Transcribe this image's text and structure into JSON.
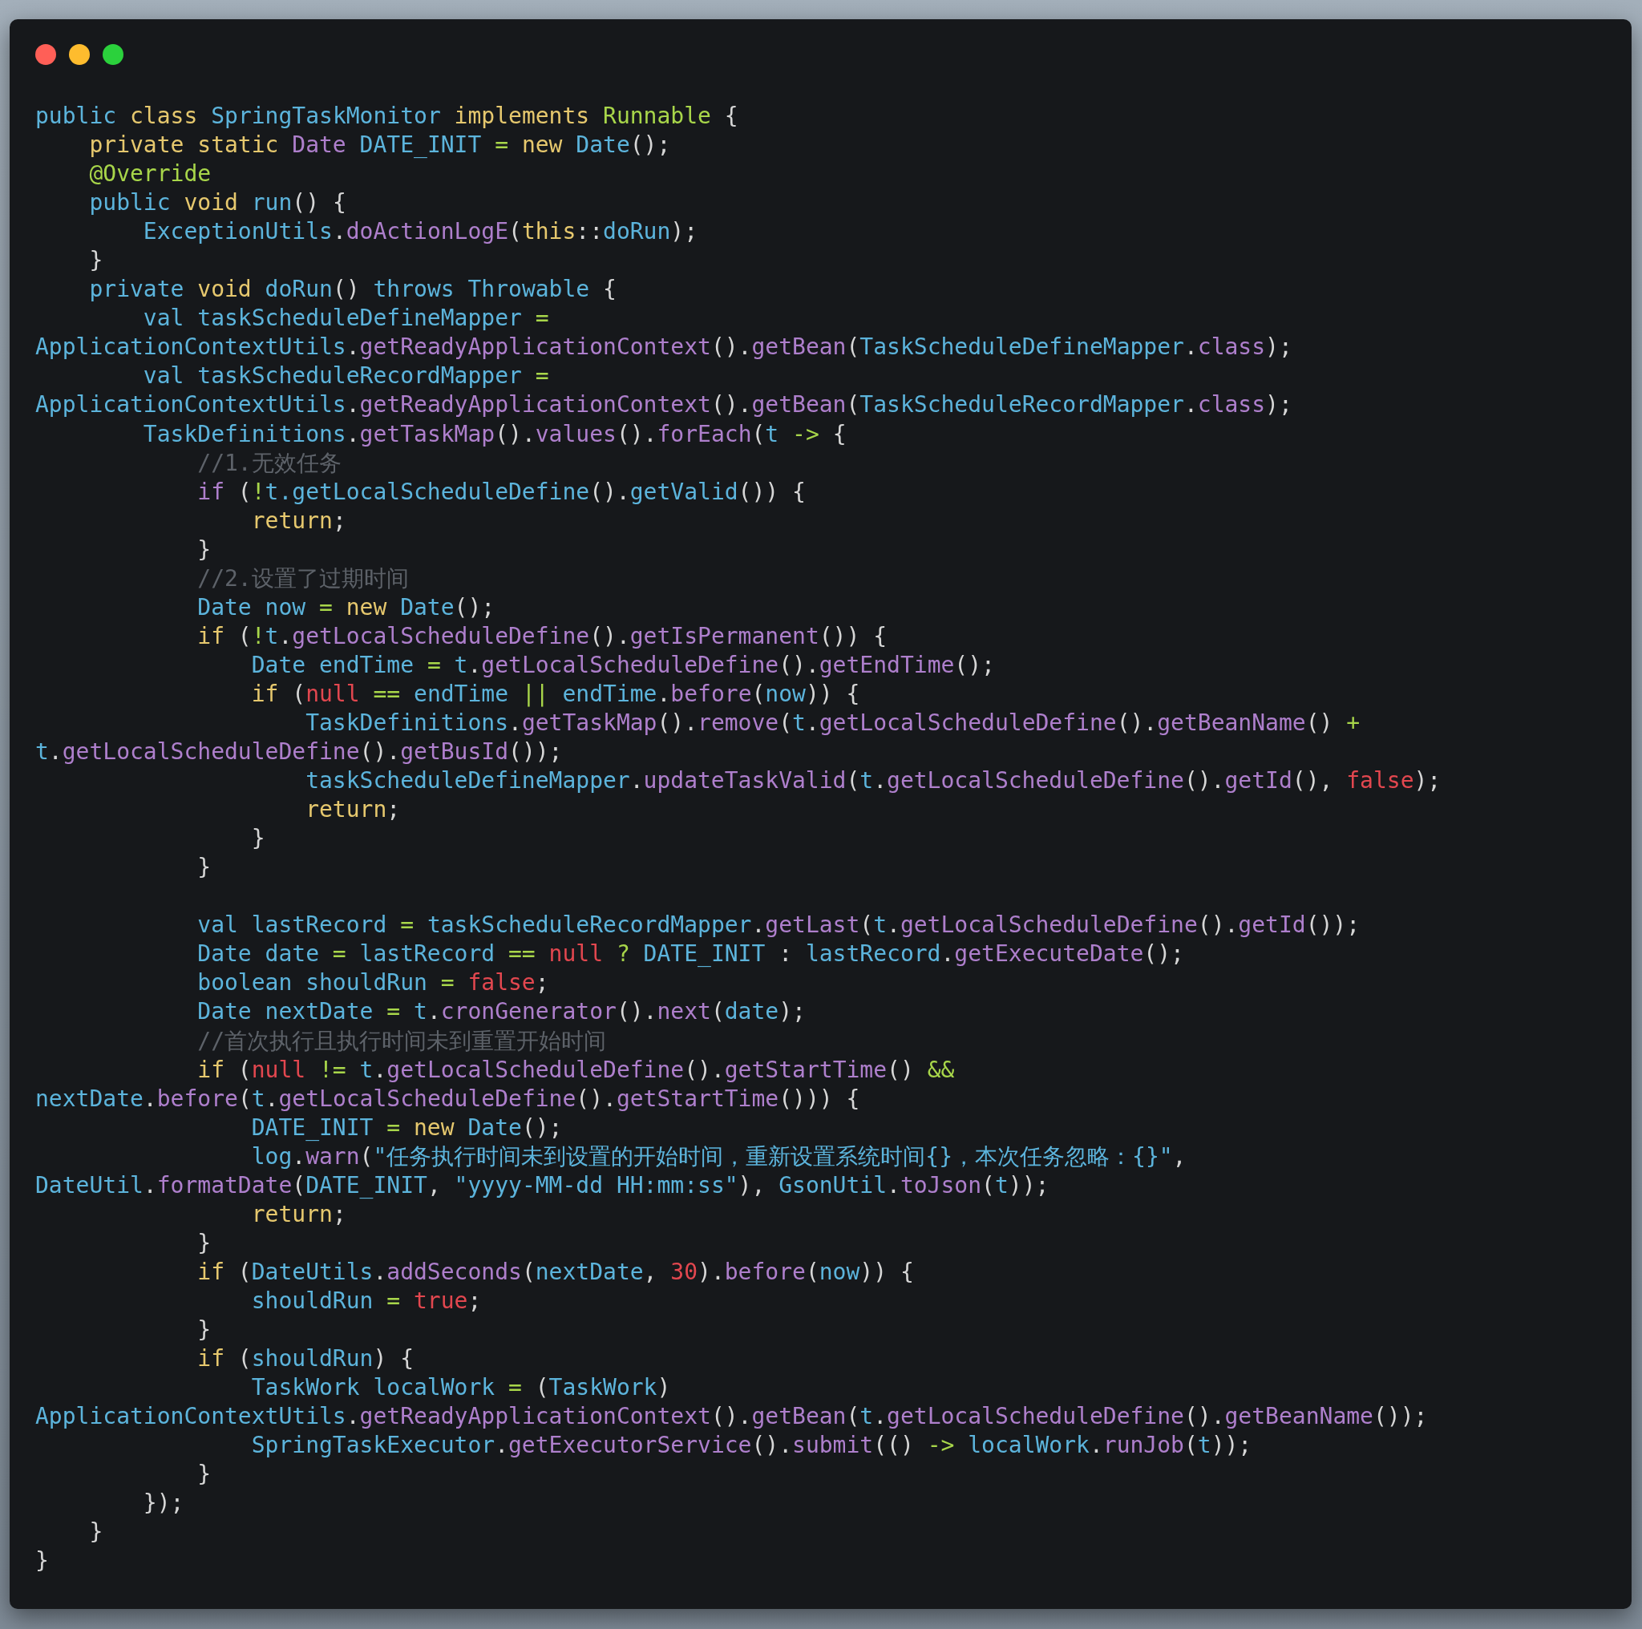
{
  "window": {
    "kind": "code-window"
  },
  "lines": [
    {
      "segments": [
        {
          "kind": "name",
          "text": "public "
        },
        {
          "kind": "keyword",
          "text": "class "
        },
        {
          "kind": "name",
          "text": "SpringTaskMonitor "
        },
        {
          "kind": "keyword",
          "text": "implements "
        },
        {
          "kind": "operator",
          "text": "Runnable "
        },
        {
          "kind": "punct",
          "text": "{"
        }
      ]
    },
    {
      "segments": [
        {
          "kind": "keyword",
          "text": "    private static "
        },
        {
          "kind": "method",
          "text": "Date "
        },
        {
          "kind": "name",
          "text": "DATE_INIT "
        },
        {
          "kind": "operator",
          "text": "= "
        },
        {
          "kind": "keyword",
          "text": "new "
        },
        {
          "kind": "name",
          "text": "Date"
        },
        {
          "kind": "punct",
          "text": "();"
        }
      ]
    },
    {
      "segments": [
        {
          "kind": "operator",
          "text": "    @Override"
        }
      ]
    },
    {
      "segments": [
        {
          "kind": "name",
          "text": "    public "
        },
        {
          "kind": "keyword",
          "text": "void "
        },
        {
          "kind": "name",
          "text": "run"
        },
        {
          "kind": "punct",
          "text": "() {"
        }
      ]
    },
    {
      "segments": [
        {
          "kind": "name",
          "text": "        ExceptionUtils"
        },
        {
          "kind": "punct",
          "text": "."
        },
        {
          "kind": "method",
          "text": "doActionLogE"
        },
        {
          "kind": "punct",
          "text": "("
        },
        {
          "kind": "keyword",
          "text": "this"
        },
        {
          "kind": "punct",
          "text": "::"
        },
        {
          "kind": "name",
          "text": "doRun"
        },
        {
          "kind": "punct",
          "text": ");"
        }
      ]
    },
    {
      "segments": [
        {
          "kind": "punct",
          "text": "    }"
        }
      ]
    },
    {
      "segments": [
        {
          "kind": "name",
          "text": "    private "
        },
        {
          "kind": "keyword",
          "text": "void "
        },
        {
          "kind": "name",
          "text": "doRun"
        },
        {
          "kind": "punct",
          "text": "() "
        },
        {
          "kind": "name",
          "text": "throws Throwable "
        },
        {
          "kind": "punct",
          "text": "{"
        }
      ]
    },
    {
      "segments": [
        {
          "kind": "name",
          "text": "        val taskScheduleDefineMapper "
        },
        {
          "kind": "operator",
          "text": "="
        }
      ]
    },
    {
      "segments": [
        {
          "kind": "name",
          "text": "ApplicationContextUtils"
        },
        {
          "kind": "punct",
          "text": "."
        },
        {
          "kind": "method",
          "text": "getReadyApplicationContext"
        },
        {
          "kind": "punct",
          "text": "()."
        },
        {
          "kind": "method",
          "text": "getBean"
        },
        {
          "kind": "punct",
          "text": "("
        },
        {
          "kind": "name",
          "text": "TaskScheduleDefineMapper"
        },
        {
          "kind": "punct",
          "text": "."
        },
        {
          "kind": "method",
          "text": "class"
        },
        {
          "kind": "punct",
          "text": ");"
        }
      ]
    },
    {
      "segments": [
        {
          "kind": "name",
          "text": "        val taskScheduleRecordMapper "
        },
        {
          "kind": "operator",
          "text": "="
        }
      ]
    },
    {
      "segments": [
        {
          "kind": "name",
          "text": "ApplicationContextUtils"
        },
        {
          "kind": "punct",
          "text": "."
        },
        {
          "kind": "method",
          "text": "getReadyApplicationContext"
        },
        {
          "kind": "punct",
          "text": "()."
        },
        {
          "kind": "method",
          "text": "getBean"
        },
        {
          "kind": "punct",
          "text": "("
        },
        {
          "kind": "name",
          "text": "TaskScheduleRecordMapper"
        },
        {
          "kind": "punct",
          "text": "."
        },
        {
          "kind": "method",
          "text": "class"
        },
        {
          "kind": "punct",
          "text": ");"
        }
      ]
    },
    {
      "segments": [
        {
          "kind": "name",
          "text": "        TaskDefinitions"
        },
        {
          "kind": "punct",
          "text": "."
        },
        {
          "kind": "method",
          "text": "getTaskMap"
        },
        {
          "kind": "punct",
          "text": "()."
        },
        {
          "kind": "method",
          "text": "values"
        },
        {
          "kind": "punct",
          "text": "()."
        },
        {
          "kind": "method",
          "text": "forEach"
        },
        {
          "kind": "punct",
          "text": "("
        },
        {
          "kind": "name",
          "text": "t "
        },
        {
          "kind": "operator",
          "text": "-> "
        },
        {
          "kind": "punct",
          "text": "{"
        }
      ]
    },
    {
      "segments": [
        {
          "kind": "comment",
          "text": "            //1.无效任务"
        }
      ]
    },
    {
      "segments": [
        {
          "kind": "method",
          "text": "            if "
        },
        {
          "kind": "punct",
          "text": "("
        },
        {
          "kind": "operator",
          "text": "!"
        },
        {
          "kind": "name",
          "text": "t.getLocalScheduleDefine"
        },
        {
          "kind": "punct",
          "text": "()."
        },
        {
          "kind": "name",
          "text": "getValid"
        },
        {
          "kind": "punct",
          "text": "()) {"
        }
      ]
    },
    {
      "segments": [
        {
          "kind": "keyword",
          "text": "                return"
        },
        {
          "kind": "punct",
          "text": ";"
        }
      ]
    },
    {
      "segments": [
        {
          "kind": "punct",
          "text": "            }"
        }
      ]
    },
    {
      "segments": [
        {
          "kind": "comment",
          "text": "            //2.设置了过期时间"
        }
      ]
    },
    {
      "segments": [
        {
          "kind": "name",
          "text": "            Date now "
        },
        {
          "kind": "operator",
          "text": "= "
        },
        {
          "kind": "keyword",
          "text": "new "
        },
        {
          "kind": "name",
          "text": "Date"
        },
        {
          "kind": "punct",
          "text": "();"
        }
      ]
    },
    {
      "segments": [
        {
          "kind": "keyword",
          "text": "            if "
        },
        {
          "kind": "punct",
          "text": "("
        },
        {
          "kind": "operator",
          "text": "!"
        },
        {
          "kind": "name",
          "text": "t"
        },
        {
          "kind": "punct",
          "text": "."
        },
        {
          "kind": "method",
          "text": "getLocalScheduleDefine"
        },
        {
          "kind": "punct",
          "text": "()."
        },
        {
          "kind": "method",
          "text": "getIsPermanent"
        },
        {
          "kind": "punct",
          "text": "()) {"
        }
      ]
    },
    {
      "segments": [
        {
          "kind": "name",
          "text": "                Date endTime "
        },
        {
          "kind": "operator",
          "text": "= "
        },
        {
          "kind": "name",
          "text": "t"
        },
        {
          "kind": "punct",
          "text": "."
        },
        {
          "kind": "method",
          "text": "getLocalScheduleDefine"
        },
        {
          "kind": "punct",
          "text": "()."
        },
        {
          "kind": "method",
          "text": "getEndTime"
        },
        {
          "kind": "punct",
          "text": "();"
        }
      ]
    },
    {
      "segments": [
        {
          "kind": "keyword",
          "text": "                if "
        },
        {
          "kind": "punct",
          "text": "("
        },
        {
          "kind": "literal",
          "text": "null "
        },
        {
          "kind": "operator",
          "text": "== "
        },
        {
          "kind": "name",
          "text": "endTime "
        },
        {
          "kind": "operator",
          "text": "|| "
        },
        {
          "kind": "name",
          "text": "endTime"
        },
        {
          "kind": "punct",
          "text": "."
        },
        {
          "kind": "method",
          "text": "before"
        },
        {
          "kind": "punct",
          "text": "("
        },
        {
          "kind": "name",
          "text": "now"
        },
        {
          "kind": "punct",
          "text": ")) {"
        }
      ]
    },
    {
      "segments": [
        {
          "kind": "name",
          "text": "                    TaskDefinitions"
        },
        {
          "kind": "punct",
          "text": "."
        },
        {
          "kind": "method",
          "text": "getTaskMap"
        },
        {
          "kind": "punct",
          "text": "()."
        },
        {
          "kind": "method",
          "text": "remove"
        },
        {
          "kind": "punct",
          "text": "("
        },
        {
          "kind": "name",
          "text": "t"
        },
        {
          "kind": "punct",
          "text": "."
        },
        {
          "kind": "method",
          "text": "getLocalScheduleDefine"
        },
        {
          "kind": "punct",
          "text": "()."
        },
        {
          "kind": "method",
          "text": "getBeanName"
        },
        {
          "kind": "punct",
          "text": "() "
        },
        {
          "kind": "operator",
          "text": "+"
        }
      ]
    },
    {
      "segments": [
        {
          "kind": "name",
          "text": "t"
        },
        {
          "kind": "punct",
          "text": "."
        },
        {
          "kind": "method",
          "text": "getLocalScheduleDefine"
        },
        {
          "kind": "punct",
          "text": "()."
        },
        {
          "kind": "method",
          "text": "getBusId"
        },
        {
          "kind": "punct",
          "text": "());"
        }
      ]
    },
    {
      "segments": [
        {
          "kind": "name",
          "text": "                    taskScheduleDefineMapper"
        },
        {
          "kind": "punct",
          "text": "."
        },
        {
          "kind": "method",
          "text": "updateTaskValid"
        },
        {
          "kind": "punct",
          "text": "("
        },
        {
          "kind": "name",
          "text": "t"
        },
        {
          "kind": "punct",
          "text": "."
        },
        {
          "kind": "method",
          "text": "getLocalScheduleDefine"
        },
        {
          "kind": "punct",
          "text": "()."
        },
        {
          "kind": "method",
          "text": "getId"
        },
        {
          "kind": "punct",
          "text": "(), "
        },
        {
          "kind": "literal",
          "text": "false"
        },
        {
          "kind": "punct",
          "text": ");"
        }
      ]
    },
    {
      "segments": [
        {
          "kind": "keyword",
          "text": "                    return"
        },
        {
          "kind": "punct",
          "text": ";"
        }
      ]
    },
    {
      "segments": [
        {
          "kind": "punct",
          "text": "                }"
        }
      ]
    },
    {
      "segments": [
        {
          "kind": "punct",
          "text": "            }"
        }
      ]
    },
    {
      "gap_before": true,
      "segments": [
        {
          "kind": "name",
          "text": "            val lastRecord "
        },
        {
          "kind": "operator",
          "text": "= "
        },
        {
          "kind": "name",
          "text": "taskScheduleRecordMapper"
        },
        {
          "kind": "punct",
          "text": "."
        },
        {
          "kind": "method",
          "text": "getLast"
        },
        {
          "kind": "punct",
          "text": "("
        },
        {
          "kind": "name",
          "text": "t"
        },
        {
          "kind": "punct",
          "text": "."
        },
        {
          "kind": "method",
          "text": "getLocalScheduleDefine"
        },
        {
          "kind": "punct",
          "text": "()."
        },
        {
          "kind": "method",
          "text": "getId"
        },
        {
          "kind": "punct",
          "text": "());"
        }
      ]
    },
    {
      "segments": [
        {
          "kind": "name",
          "text": "            Date date "
        },
        {
          "kind": "operator",
          "text": "= "
        },
        {
          "kind": "name",
          "text": "lastRecord "
        },
        {
          "kind": "operator",
          "text": "== "
        },
        {
          "kind": "literal",
          "text": "null "
        },
        {
          "kind": "operator",
          "text": "? "
        },
        {
          "kind": "name",
          "text": "DATE_INIT "
        },
        {
          "kind": "punct",
          "text": ": "
        },
        {
          "kind": "name",
          "text": "lastRecord"
        },
        {
          "kind": "punct",
          "text": "."
        },
        {
          "kind": "method",
          "text": "getExecuteDate"
        },
        {
          "kind": "punct",
          "text": "();"
        }
      ]
    },
    {
      "segments": [
        {
          "kind": "name",
          "text": "            boolean shouldRun "
        },
        {
          "kind": "operator",
          "text": "= "
        },
        {
          "kind": "literal",
          "text": "false"
        },
        {
          "kind": "punct",
          "text": ";"
        }
      ]
    },
    {
      "segments": [
        {
          "kind": "name",
          "text": "            Date nextDate "
        },
        {
          "kind": "operator",
          "text": "= "
        },
        {
          "kind": "name",
          "text": "t"
        },
        {
          "kind": "punct",
          "text": "."
        },
        {
          "kind": "method",
          "text": "cronGenerator"
        },
        {
          "kind": "punct",
          "text": "()."
        },
        {
          "kind": "method",
          "text": "next"
        },
        {
          "kind": "punct",
          "text": "("
        },
        {
          "kind": "name",
          "text": "date"
        },
        {
          "kind": "punct",
          "text": ");"
        }
      ]
    },
    {
      "segments": [
        {
          "kind": "comment",
          "text": "            //首次执行且执行时间未到重置开始时间"
        }
      ]
    },
    {
      "segments": [
        {
          "kind": "keyword",
          "text": "            if "
        },
        {
          "kind": "punct",
          "text": "("
        },
        {
          "kind": "literal",
          "text": "null "
        },
        {
          "kind": "operator",
          "text": "!= "
        },
        {
          "kind": "name",
          "text": "t"
        },
        {
          "kind": "punct",
          "text": "."
        },
        {
          "kind": "method",
          "text": "getLocalScheduleDefine"
        },
        {
          "kind": "punct",
          "text": "()."
        },
        {
          "kind": "method",
          "text": "getStartTime"
        },
        {
          "kind": "punct",
          "text": "() "
        },
        {
          "kind": "operator",
          "text": "&&"
        }
      ]
    },
    {
      "segments": [
        {
          "kind": "name",
          "text": "nextDate"
        },
        {
          "kind": "punct",
          "text": "."
        },
        {
          "kind": "method",
          "text": "before"
        },
        {
          "kind": "punct",
          "text": "("
        },
        {
          "kind": "name",
          "text": "t"
        },
        {
          "kind": "punct",
          "text": "."
        },
        {
          "kind": "method",
          "text": "getLocalScheduleDefine"
        },
        {
          "kind": "punct",
          "text": "()."
        },
        {
          "kind": "method",
          "text": "getStartTime"
        },
        {
          "kind": "punct",
          "text": "())) {"
        }
      ]
    },
    {
      "segments": [
        {
          "kind": "name",
          "text": "                DATE_INIT "
        },
        {
          "kind": "operator",
          "text": "= "
        },
        {
          "kind": "keyword",
          "text": "new "
        },
        {
          "kind": "name",
          "text": "Date"
        },
        {
          "kind": "punct",
          "text": "();"
        }
      ]
    },
    {
      "segments": [
        {
          "kind": "name",
          "text": "                log"
        },
        {
          "kind": "punct",
          "text": "."
        },
        {
          "kind": "method",
          "text": "warn"
        },
        {
          "kind": "punct",
          "text": "("
        },
        {
          "kind": "name",
          "text": "\"任务执行时间未到设置的开始时间，重新设置系统时间{}，本次任务忽略：{}\""
        },
        {
          "kind": "punct",
          "text": ","
        }
      ]
    },
    {
      "segments": [
        {
          "kind": "name",
          "text": "DateUtil"
        },
        {
          "kind": "punct",
          "text": "."
        },
        {
          "kind": "method",
          "text": "formatDate"
        },
        {
          "kind": "punct",
          "text": "("
        },
        {
          "kind": "name",
          "text": "DATE_INIT"
        },
        {
          "kind": "punct",
          "text": ", "
        },
        {
          "kind": "name",
          "text": "\"yyyy-MM-dd HH:mm:ss\""
        },
        {
          "kind": "punct",
          "text": "), "
        },
        {
          "kind": "name",
          "text": "GsonUtil"
        },
        {
          "kind": "punct",
          "text": "."
        },
        {
          "kind": "method",
          "text": "toJson"
        },
        {
          "kind": "punct",
          "text": "("
        },
        {
          "kind": "name",
          "text": "t"
        },
        {
          "kind": "punct",
          "text": "));"
        }
      ]
    },
    {
      "segments": [
        {
          "kind": "keyword",
          "text": "                return"
        },
        {
          "kind": "punct",
          "text": ";"
        }
      ]
    },
    {
      "segments": [
        {
          "kind": "punct",
          "text": "            }"
        }
      ]
    },
    {
      "segments": [
        {
          "kind": "keyword",
          "text": "            if "
        },
        {
          "kind": "punct",
          "text": "("
        },
        {
          "kind": "name",
          "text": "DateUtils"
        },
        {
          "kind": "punct",
          "text": "."
        },
        {
          "kind": "method",
          "text": "addSeconds"
        },
        {
          "kind": "punct",
          "text": "("
        },
        {
          "kind": "name",
          "text": "nextDate"
        },
        {
          "kind": "punct",
          "text": ", "
        },
        {
          "kind": "literal",
          "text": "30"
        },
        {
          "kind": "punct",
          "text": ")."
        },
        {
          "kind": "method",
          "text": "before"
        },
        {
          "kind": "punct",
          "text": "("
        },
        {
          "kind": "name",
          "text": "now"
        },
        {
          "kind": "punct",
          "text": ")) {"
        }
      ]
    },
    {
      "segments": [
        {
          "kind": "name",
          "text": "                shouldRun "
        },
        {
          "kind": "operator",
          "text": "= "
        },
        {
          "kind": "literal",
          "text": "true"
        },
        {
          "kind": "punct",
          "text": ";"
        }
      ]
    },
    {
      "segments": [
        {
          "kind": "punct",
          "text": "            }"
        }
      ]
    },
    {
      "segments": [
        {
          "kind": "keyword",
          "text": "            if "
        },
        {
          "kind": "punct",
          "text": "("
        },
        {
          "kind": "name",
          "text": "shouldRun"
        },
        {
          "kind": "punct",
          "text": ") {"
        }
      ]
    },
    {
      "segments": [
        {
          "kind": "name",
          "text": "                TaskWork localWork "
        },
        {
          "kind": "operator",
          "text": "= "
        },
        {
          "kind": "punct",
          "text": "("
        },
        {
          "kind": "name",
          "text": "TaskWork"
        },
        {
          "kind": "punct",
          "text": ")"
        }
      ]
    },
    {
      "segments": [
        {
          "kind": "name",
          "text": "ApplicationContextUtils"
        },
        {
          "kind": "punct",
          "text": "."
        },
        {
          "kind": "method",
          "text": "getReadyApplicationContext"
        },
        {
          "kind": "punct",
          "text": "()."
        },
        {
          "kind": "method",
          "text": "getBean"
        },
        {
          "kind": "punct",
          "text": "("
        },
        {
          "kind": "name",
          "text": "t"
        },
        {
          "kind": "punct",
          "text": "."
        },
        {
          "kind": "method",
          "text": "getLocalScheduleDefine"
        },
        {
          "kind": "punct",
          "text": "()."
        },
        {
          "kind": "method",
          "text": "getBeanName"
        },
        {
          "kind": "punct",
          "text": "());"
        }
      ]
    },
    {
      "segments": [
        {
          "kind": "name",
          "text": "                SpringTaskExecutor"
        },
        {
          "kind": "punct",
          "text": "."
        },
        {
          "kind": "method",
          "text": "getExecutorService"
        },
        {
          "kind": "punct",
          "text": "()."
        },
        {
          "kind": "method",
          "text": "submit"
        },
        {
          "kind": "punct",
          "text": "(() "
        },
        {
          "kind": "operator",
          "text": "-> "
        },
        {
          "kind": "name",
          "text": "localWork"
        },
        {
          "kind": "punct",
          "text": "."
        },
        {
          "kind": "method",
          "text": "runJob"
        },
        {
          "kind": "punct",
          "text": "("
        },
        {
          "kind": "name",
          "text": "t"
        },
        {
          "kind": "punct",
          "text": "));"
        }
      ]
    },
    {
      "segments": [
        {
          "kind": "punct",
          "text": "            }"
        }
      ]
    },
    {
      "segments": [
        {
          "kind": "punct",
          "text": "        });"
        }
      ]
    },
    {
      "segments": [
        {
          "kind": "punct",
          "text": "    }"
        }
      ]
    },
    {
      "segments": [
        {
          "kind": "punct",
          "text": "}"
        }
      ]
    }
  ]
}
